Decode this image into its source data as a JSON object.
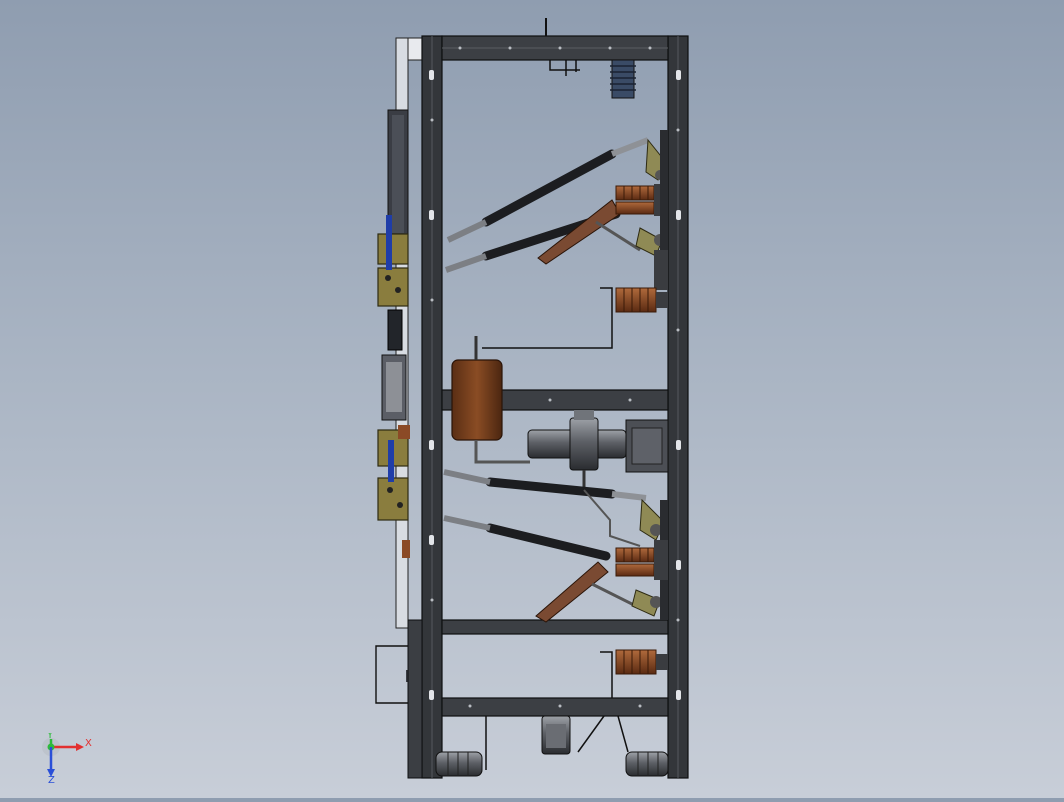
{
  "view": {
    "background_top": "#8f9db0",
    "background_bottom": "#c8ced8"
  },
  "colors": {
    "frame_dark": "#2e3033",
    "frame_mid": "#4a4d52",
    "insulator_brown": "#8b4a26",
    "copper": "#a0522d",
    "arm_khaki": "#8f8a55",
    "busbar_brown": "#6b4030",
    "blue_part": "#1f3da8",
    "ceramic_blue": "#3a4b66",
    "axis_x": "#e23030",
    "axis_y": "#2dbb3a",
    "axis_z": "#2a4fd8"
  },
  "triad": {
    "x_label": "X",
    "y_label": "Y",
    "z_label": "Z",
    "x_icon": "x-axis-arrow-icon",
    "y_icon": "y-axis-arrow-icon",
    "z_icon": "z-axis-arrow-icon"
  }
}
